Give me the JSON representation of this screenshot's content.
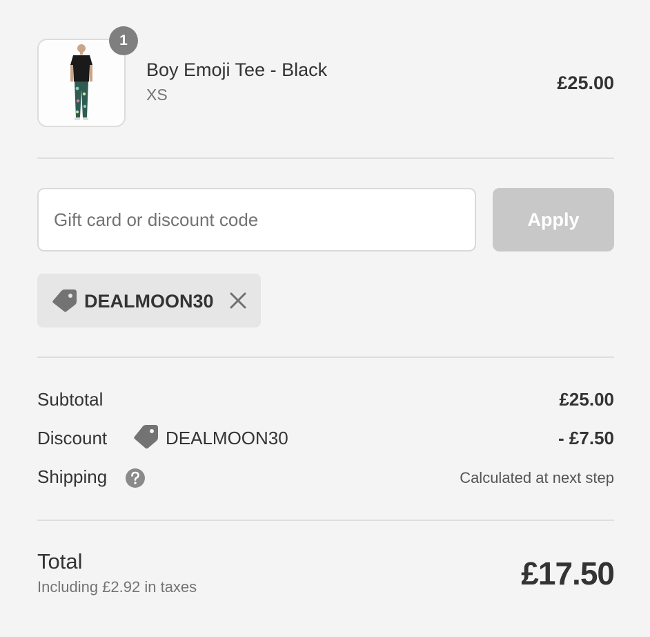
{
  "product": {
    "quantity": "1",
    "name": "Boy Emoji Tee - Black",
    "variant": "XS",
    "price": "£25.00"
  },
  "discount_form": {
    "placeholder": "Gift card or discount code",
    "value": "",
    "apply_label": "Apply"
  },
  "applied_code": {
    "code": "DEALMOON30"
  },
  "summary": {
    "subtotal_label": "Subtotal",
    "subtotal_value": "£25.00",
    "discount_label": "Discount",
    "discount_code": "DEALMOON30",
    "discount_value": "- £7.50",
    "shipping_label": "Shipping",
    "shipping_value": "Calculated at next step"
  },
  "total": {
    "label": "Total",
    "tax_note": "Including £2.92 in taxes",
    "value": "£17.50"
  },
  "colors": {
    "background": "#f4f4f4",
    "apply_button": "#c8c8c8",
    "chip_background": "#e6e6e6",
    "badge": "#7f7f7f"
  }
}
